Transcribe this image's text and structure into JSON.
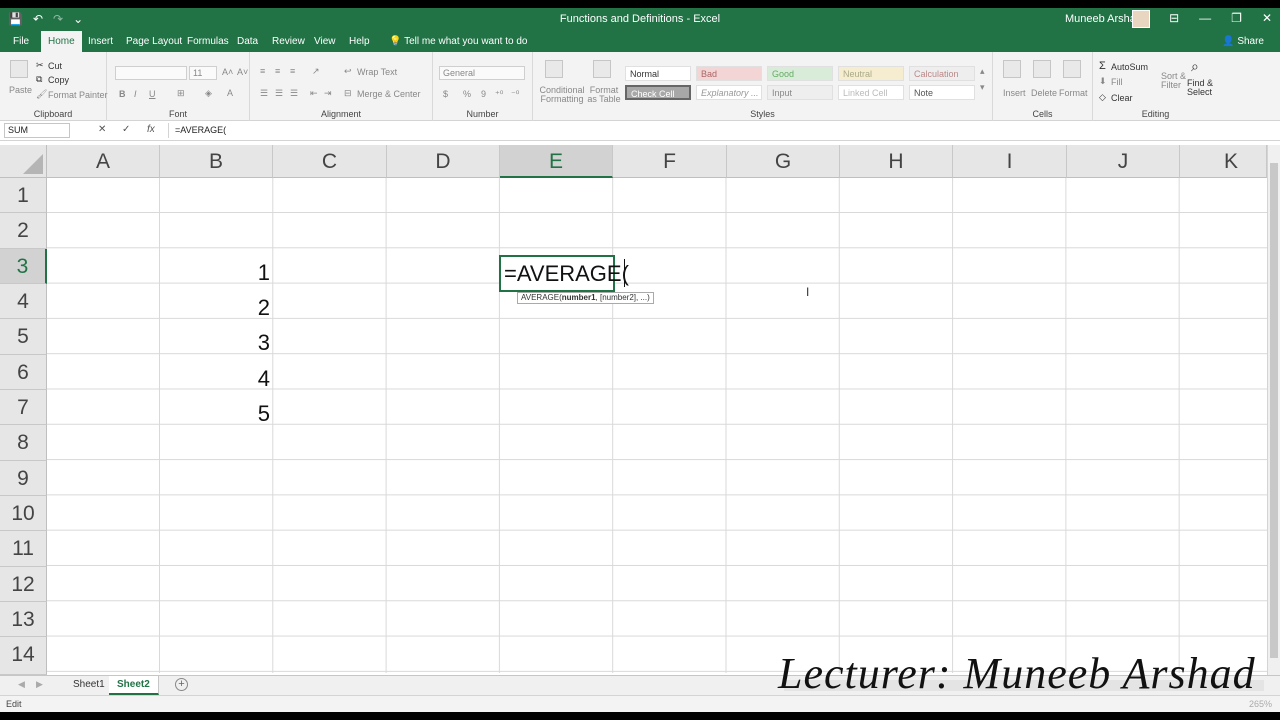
{
  "window": {
    "title": "Functions and Definitions  -  Excel",
    "user": "Muneeb Arshad",
    "minimize": "—",
    "restore": "❐",
    "close": "✕",
    "ribbon_display": "⊟"
  },
  "qat": {
    "save": "💾",
    "undo": "↶",
    "redo": "↷",
    "customize": "⌄"
  },
  "tabs": [
    "File",
    "Home",
    "Insert",
    "Page Layout",
    "Formulas",
    "Data",
    "Review",
    "View",
    "Help"
  ],
  "active_tab": "Home",
  "tell_me": "Tell me what you want to do",
  "share": "Share",
  "ribbon": {
    "clipboard": {
      "label": "Clipboard",
      "paste": "Paste",
      "cut": "Cut",
      "copy": "Copy",
      "format_painter": "Format Painter"
    },
    "font": {
      "label": "Font",
      "font_size": "11",
      "grow": "A˄",
      "shrink": "A˅",
      "bold": "B",
      "italic": "I",
      "underline": "U"
    },
    "alignment": {
      "label": "Alignment",
      "wrap_text": "Wrap Text",
      "merge_center": "Merge & Center"
    },
    "number": {
      "label": "Number",
      "format": "General",
      "currency": "$",
      "percent": "%",
      "comma": "9"
    },
    "styles": {
      "label": "Styles",
      "conditional": "Conditional Formatting",
      "format_table": "Format as Table",
      "cells": [
        "Normal",
        "Bad",
        "Good",
        "Neutral",
        "Calculation",
        "Check Cell",
        "Explanatory ...",
        "Input",
        "Linked Cell",
        "Note"
      ]
    },
    "cells_group": {
      "label": "Cells",
      "insert": "Insert",
      "delete": "Delete",
      "format": "Format"
    },
    "editing": {
      "label": "Editing",
      "autosum": "AutoSum",
      "fill": "Fill",
      "clear": "Clear",
      "sort_filter": "Sort & Filter",
      "find_select": "Find & Select"
    }
  },
  "formula_bar": {
    "name_box": "SUM",
    "cancel": "✕",
    "enter": "✓",
    "fx": "fx",
    "content": "=AVERAGE("
  },
  "grid": {
    "columns": [
      "A",
      "B",
      "C",
      "D",
      "E",
      "F",
      "G",
      "H",
      "I",
      "J",
      "K"
    ],
    "selected_column": "E",
    "rows": [
      "1",
      "2",
      "3",
      "4",
      "5",
      "6",
      "7",
      "8",
      "9",
      "10",
      "11",
      "12",
      "13",
      "14"
    ],
    "selected_row": "3",
    "values_col_b": [
      "1",
      "2",
      "3",
      "4",
      "5"
    ],
    "active_cell_text": "=AVERAGE(",
    "tooltip": {
      "fn": "AVERAGE(",
      "arg1": "number1",
      "rest": ", [number2], ...)"
    }
  },
  "sheets": [
    "Sheet1",
    "Sheet2"
  ],
  "active_sheet": "Sheet2",
  "status": {
    "mode": "Edit",
    "zoom": "265%"
  },
  "watermark": "Lecturer: Muneeb Arshad",
  "colors": {
    "excel_green": "#217346",
    "ribbon_bg": "#f3f3f3"
  }
}
